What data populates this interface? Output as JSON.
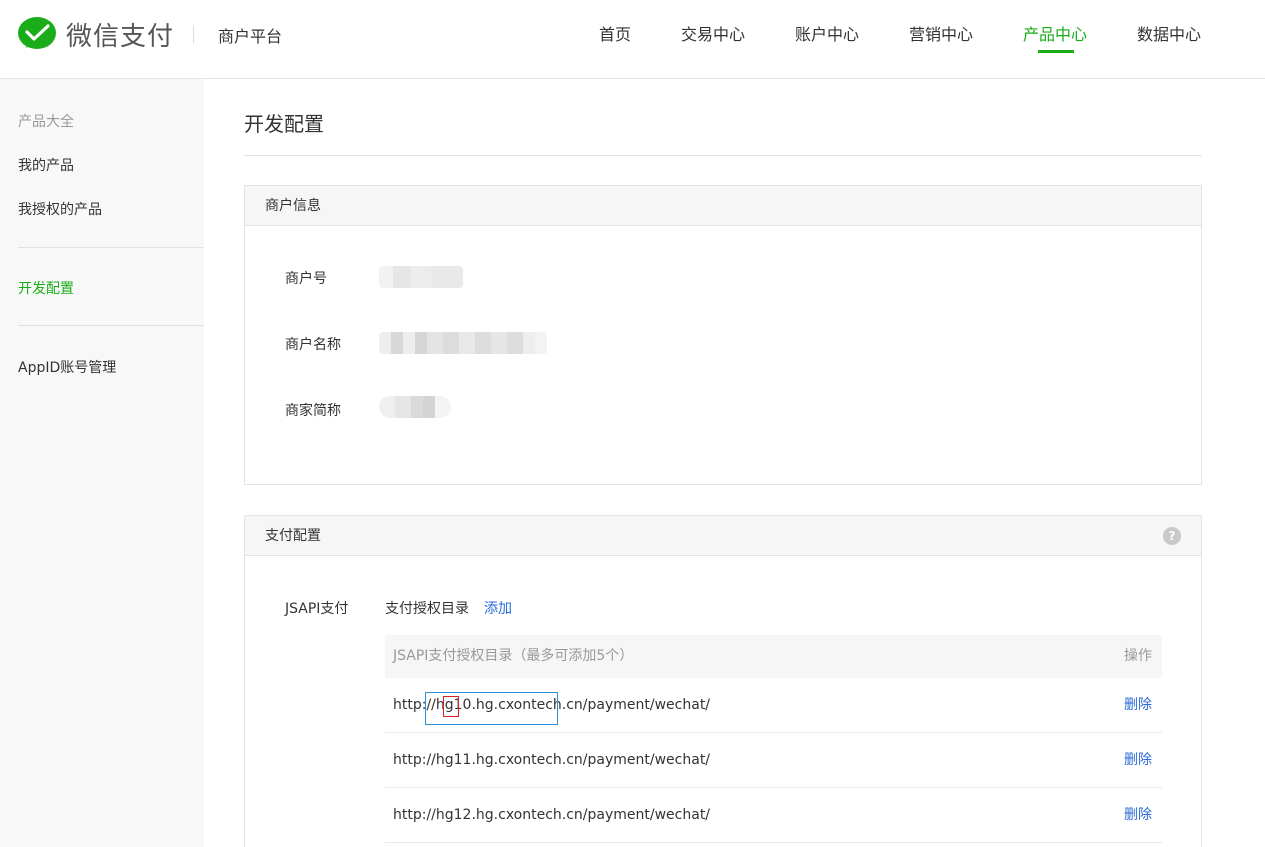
{
  "brand": {
    "logo_text": "微信支付",
    "platform": "商户平台",
    "accent": "#1aad19"
  },
  "nav": [
    {
      "label": "首页",
      "active": false
    },
    {
      "label": "交易中心",
      "active": false
    },
    {
      "label": "账户中心",
      "active": false
    },
    {
      "label": "营销中心",
      "active": false
    },
    {
      "label": "产品中心",
      "active": true
    },
    {
      "label": "数据中心",
      "active": false
    }
  ],
  "sidebar": {
    "items": [
      {
        "label": "产品大全"
      },
      {
        "label": "我的产品"
      },
      {
        "label": "我授权的产品"
      },
      {
        "label": "开发配置"
      },
      {
        "label": "AppID账号管理"
      }
    ]
  },
  "page": {
    "title": "开发配置"
  },
  "merchant_info": {
    "title": "商户信息",
    "fields": [
      {
        "label": "商户号"
      },
      {
        "label": "商户名称"
      },
      {
        "label": "商家简称"
      }
    ]
  },
  "pay_config": {
    "title": "支付配置",
    "help_icon": "question-icon",
    "jsapi_label": "JSAPI支付",
    "dir_label": "支付授权目录",
    "add_label": "添加",
    "table": {
      "col_dir": "JSAPI支付授权目录（最多可添加5个）",
      "col_op": "操作",
      "rows": [
        {
          "url": "http://hg10.hg.cxontech.cn/payment/wechat/",
          "action": "删除"
        },
        {
          "url": "http://hg11.hg.cxontech.cn/payment/wechat/",
          "action": "删除"
        },
        {
          "url": "http://hg12.hg.cxontech.cn/payment/wechat/",
          "action": "删除"
        }
      ]
    }
  }
}
